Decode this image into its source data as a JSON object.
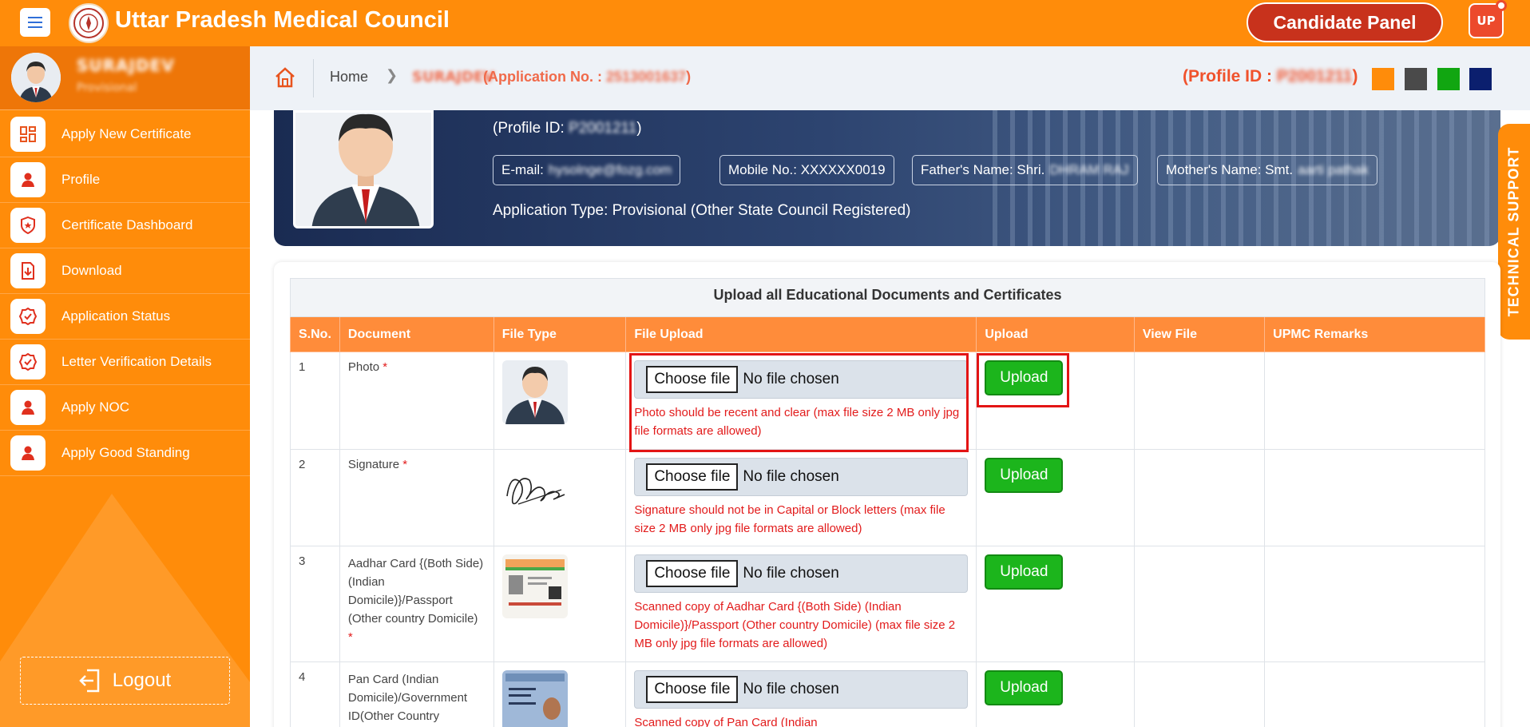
{
  "header": {
    "brand": "Uttar Pradesh Medical Council",
    "candidate_panel": "Candidate Panel",
    "user_badge": "UP"
  },
  "sidebar": {
    "user_name": "SURAJDEV",
    "user_role": "Provisional",
    "items": [
      {
        "label": "Apply New Certificate",
        "icon": "grid-icon"
      },
      {
        "label": "Profile",
        "icon": "user-icon"
      },
      {
        "label": "Certificate Dashboard",
        "icon": "shield-icon"
      },
      {
        "label": "Download",
        "icon": "download-icon"
      },
      {
        "label": "Application Status",
        "icon": "check-badge-icon"
      },
      {
        "label": "Letter Verification Details",
        "icon": "check-badge-icon"
      },
      {
        "label": "Apply NOC",
        "icon": "user-icon"
      },
      {
        "label": "Apply Good Standing",
        "icon": "user-icon"
      }
    ],
    "logout": "Logout"
  },
  "breadcrumb": {
    "home": "Home",
    "name": "SURAJDEV",
    "app_prefix": "(Application No. : ",
    "app_no": "2513001637",
    "app_suffix": ")",
    "profile_prefix": "(Profile ID : ",
    "profile_id": "P2001211",
    "profile_suffix": ")",
    "theme_colors": [
      "#ff8c0a",
      "#4a4a4a",
      "#11a611",
      "#0b1f6e"
    ]
  },
  "banner": {
    "profile_prefix": "(Profile ID: ",
    "profile_id": "P2001211",
    "profile_suffix": ")",
    "email_label": "E-mail:",
    "email": "hysolnge@fozg.com",
    "mobile": "Mobile No.: XXXXXX0019",
    "father_label": "Father's Name: Shri.",
    "father": "DHRAM RAJ",
    "mother_label": "Mother's Name: Smt.",
    "mother": "aarti pathak",
    "application_type": "Application Type: Provisional (Other State Council Registered)"
  },
  "tech_support": "TECHNICAL SUPPORT",
  "table": {
    "caption": "Upload all Educational Documents and Certificates",
    "headers": [
      "S.No.",
      "Document",
      "File Type",
      "File Upload",
      "Upload",
      "View File",
      "UPMC Remarks"
    ],
    "choose_label": "Choose file",
    "no_file_label": "No file chosen",
    "upload_label": "Upload",
    "rows": [
      {
        "sno": "1",
        "document": "Photo",
        "required": "*",
        "hint": "Photo should be recent and clear (max file size 2 MB only jpg file formats are allowed)"
      },
      {
        "sno": "2",
        "document": "Signature",
        "required": "*",
        "hint": "Signature should not be in Capital or Block letters (max file size 2 MB only jpg file formats are allowed)"
      },
      {
        "sno": "3",
        "document": "Aadhar Card {(Both Side) (Indian Domicile)}/Passport (Other country Domicile)",
        "required": "*",
        "hint": "Scanned copy of Aadhar Card {(Both Side) (Indian Domicile)}/Passport (Other country Domicile) (max file size 2 MB only jpg file formats are allowed)"
      },
      {
        "sno": "4",
        "document": "Pan Card (Indian Domicile)/Government ID(Other Country",
        "required": "",
        "hint": "Scanned copy of Pan Card (Indian"
      }
    ]
  }
}
